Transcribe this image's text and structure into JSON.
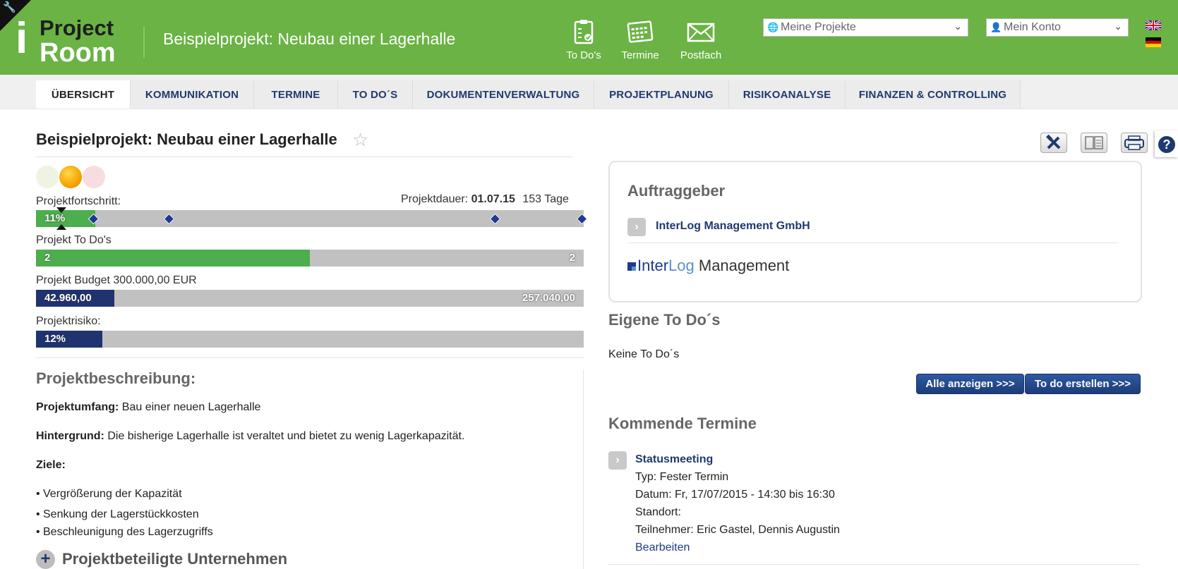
{
  "header": {
    "logo": {
      "i": "i",
      "project": "Project",
      "room": "Room"
    },
    "title": "Beispielprojekt: Neubau einer Lagerhalle",
    "nav": [
      {
        "label": "To Do's",
        "icon": "clipboard-check-icon"
      },
      {
        "label": "Termine",
        "icon": "calendar-icon"
      },
      {
        "label": "Postfach",
        "icon": "envelope-icon"
      }
    ],
    "projects_select": "Meine Projekte",
    "account_select": "Mein Konto",
    "flags": [
      "flag-uk-icon",
      "flag-de-icon"
    ]
  },
  "tabs": [
    {
      "label": "ÜBERSICHT",
      "active": true
    },
    {
      "label": "KOMMUNIKATION"
    },
    {
      "label": "TERMINE"
    },
    {
      "label": "TO DO´S"
    },
    {
      "label": "DOKUMENTENVERWALTUNG"
    },
    {
      "label": "PROJEKTPLANUNG"
    },
    {
      "label": "RISIKOANALYSE"
    },
    {
      "label": "FINANZEN & CONTROLLING"
    }
  ],
  "project": {
    "title": "Beispielprojekt: Neubau einer Lagerhalle",
    "status_light": "orange",
    "progress": {
      "label": "Projektfortschritt:",
      "value_text": "11%",
      "value": 0.11,
      "duration_label": "Projektdauer:",
      "duration_date": "01.07.15",
      "duration_days": "153 Tage"
    },
    "todos": {
      "label": "Projekt To Do's",
      "done": "2",
      "total": "2",
      "fraction": 0.5
    },
    "budget": {
      "label": "Projekt Budget 300.000,00 EUR",
      "spent": "42.960,00",
      "remaining": "257.040,00",
      "fraction": 0.143
    },
    "risk": {
      "label": "Projektrisiko:",
      "value_text": "12%",
      "value": 0.12
    }
  },
  "description": {
    "heading": "Projektbeschreibung:",
    "scope_label": "Projektumfang:",
    "scope_text": "Bau einer neuen Lagerhalle",
    "background_label": "Hintergrund:",
    "background_text": "Die bisherige Lagerhalle ist veraltet und bietet zu wenig Lagerkapazität.",
    "goals_label": "Ziele:",
    "goals": [
      "Vergrößerung der Kapazität",
      "Senkung der Lagerstückkosten",
      "Beschleunigung des Lagerzugriffs"
    ],
    "companies_heading": "Projektbeteiligte Unternehmen"
  },
  "client": {
    "heading": "Auftraggeber",
    "name": "InterLog Management GmbH",
    "logo_inter": "Inter",
    "logo_log": "Log",
    "logo_management": " Management"
  },
  "own_todos": {
    "heading": "Eigene To Do´s",
    "empty": "Keine To Do´s",
    "show_all": "Alle anzeigen >>>",
    "create": "To do erstellen >>>"
  },
  "upcoming": {
    "heading": "Kommende Termine",
    "events": [
      {
        "title": "Statusmeeting",
        "type": "Typ: Fester Termin",
        "date": "Datum: Fr, 17/07/2015 - 14:30 bis 16:30",
        "location": "Standort:",
        "participants": "Teilnehmer: Eric Gastel, Dennis Augustin",
        "edit": "Bearbeiten"
      }
    ]
  },
  "help": "?"
}
